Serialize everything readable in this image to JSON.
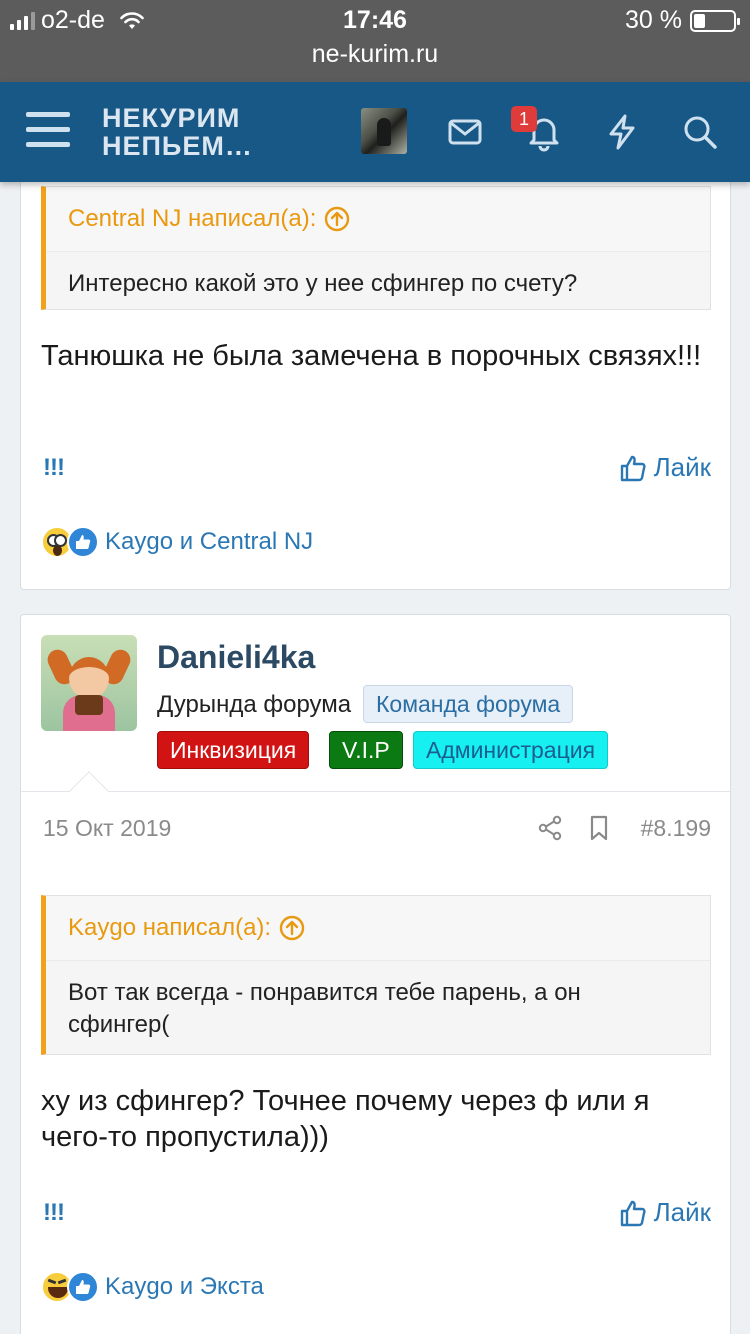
{
  "status_bar": {
    "carrier": "o2-de",
    "time": "17:46",
    "battery": "30 %",
    "battery_level": 0.3,
    "url": "ne-kurim.ru"
  },
  "header": {
    "logo_line1": "НЕКУРИМ",
    "logo_line2": "НЕПЬЕМ…",
    "notifications_count": "1",
    "icons": [
      "menu-icon",
      "user-avatar",
      "mail-icon",
      "bell-icon",
      "lightning-icon",
      "search-icon"
    ]
  },
  "posts": [
    {
      "quote": {
        "author_line": "Central NJ написал(а):",
        "text": "Интересно какой это у нее сфингер по счету?"
      },
      "message": "Танюшка не была замечена в порочных связях!!!",
      "exclaim": "!!!",
      "like_label": "Лайк",
      "reactions": [
        "wow",
        "like"
      ],
      "reacted_by": "Kaygo и Central NJ"
    },
    {
      "user": {
        "name": "Danieli4ka",
        "title": "Дурында форума",
        "tags": [
          "Команда форума",
          "Инквизиция",
          "V.I.P",
          "Администрация"
        ]
      },
      "date": "15 Окт 2019",
      "post_number": "#8.199",
      "quote": {
        "author_line": "Kaygo написал(а):",
        "text": "Вот так всегда - понравится тебе парень, а он сфингер("
      },
      "message": "ху из сфингер? Точнее почему через ф или я чего-то пропустила)))",
      "exclaim": "!!!",
      "like_label": "Лайк",
      "reactions": [
        "laugh",
        "like"
      ],
      "reacted_by": "Kaygo и Экста"
    }
  ],
  "colors": {
    "header_bg": "#185886",
    "status_bg": "#5c5c5c",
    "link": "#2b77b4",
    "quote_accent": "#f0a21b",
    "tag_inquisition": "#d21313",
    "tag_vip": "#0c7a13",
    "tag_admin": "#16f0f0"
  }
}
